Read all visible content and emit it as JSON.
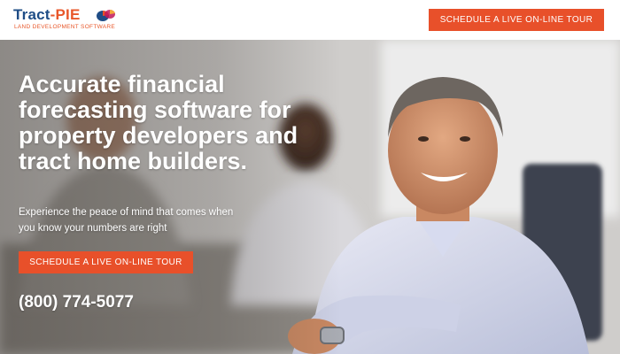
{
  "header": {
    "logo": {
      "word_tract": "Tract",
      "word_dot": "-",
      "word_pie": "PIE",
      "tagline": "LAND DEVELOPMENT SOFTWARE"
    },
    "cta_label": "SCHEDULE A LIVE ON-LINE TOUR"
  },
  "hero": {
    "headline": "Accurate financial forecasting software for property developers and tract home builders.",
    "subtext": "Experience the peace of mind that comes when you know your numbers are right",
    "cta_label": "SCHEDULE A LIVE ON-LINE TOUR",
    "phone": "(800) 774-5077"
  },
  "colors": {
    "accent": "#e8502a",
    "brand_blue": "#1f4d86",
    "hero_text": "#ffffff"
  },
  "icons": {
    "logo_mark": "pie-chart-icon"
  }
}
